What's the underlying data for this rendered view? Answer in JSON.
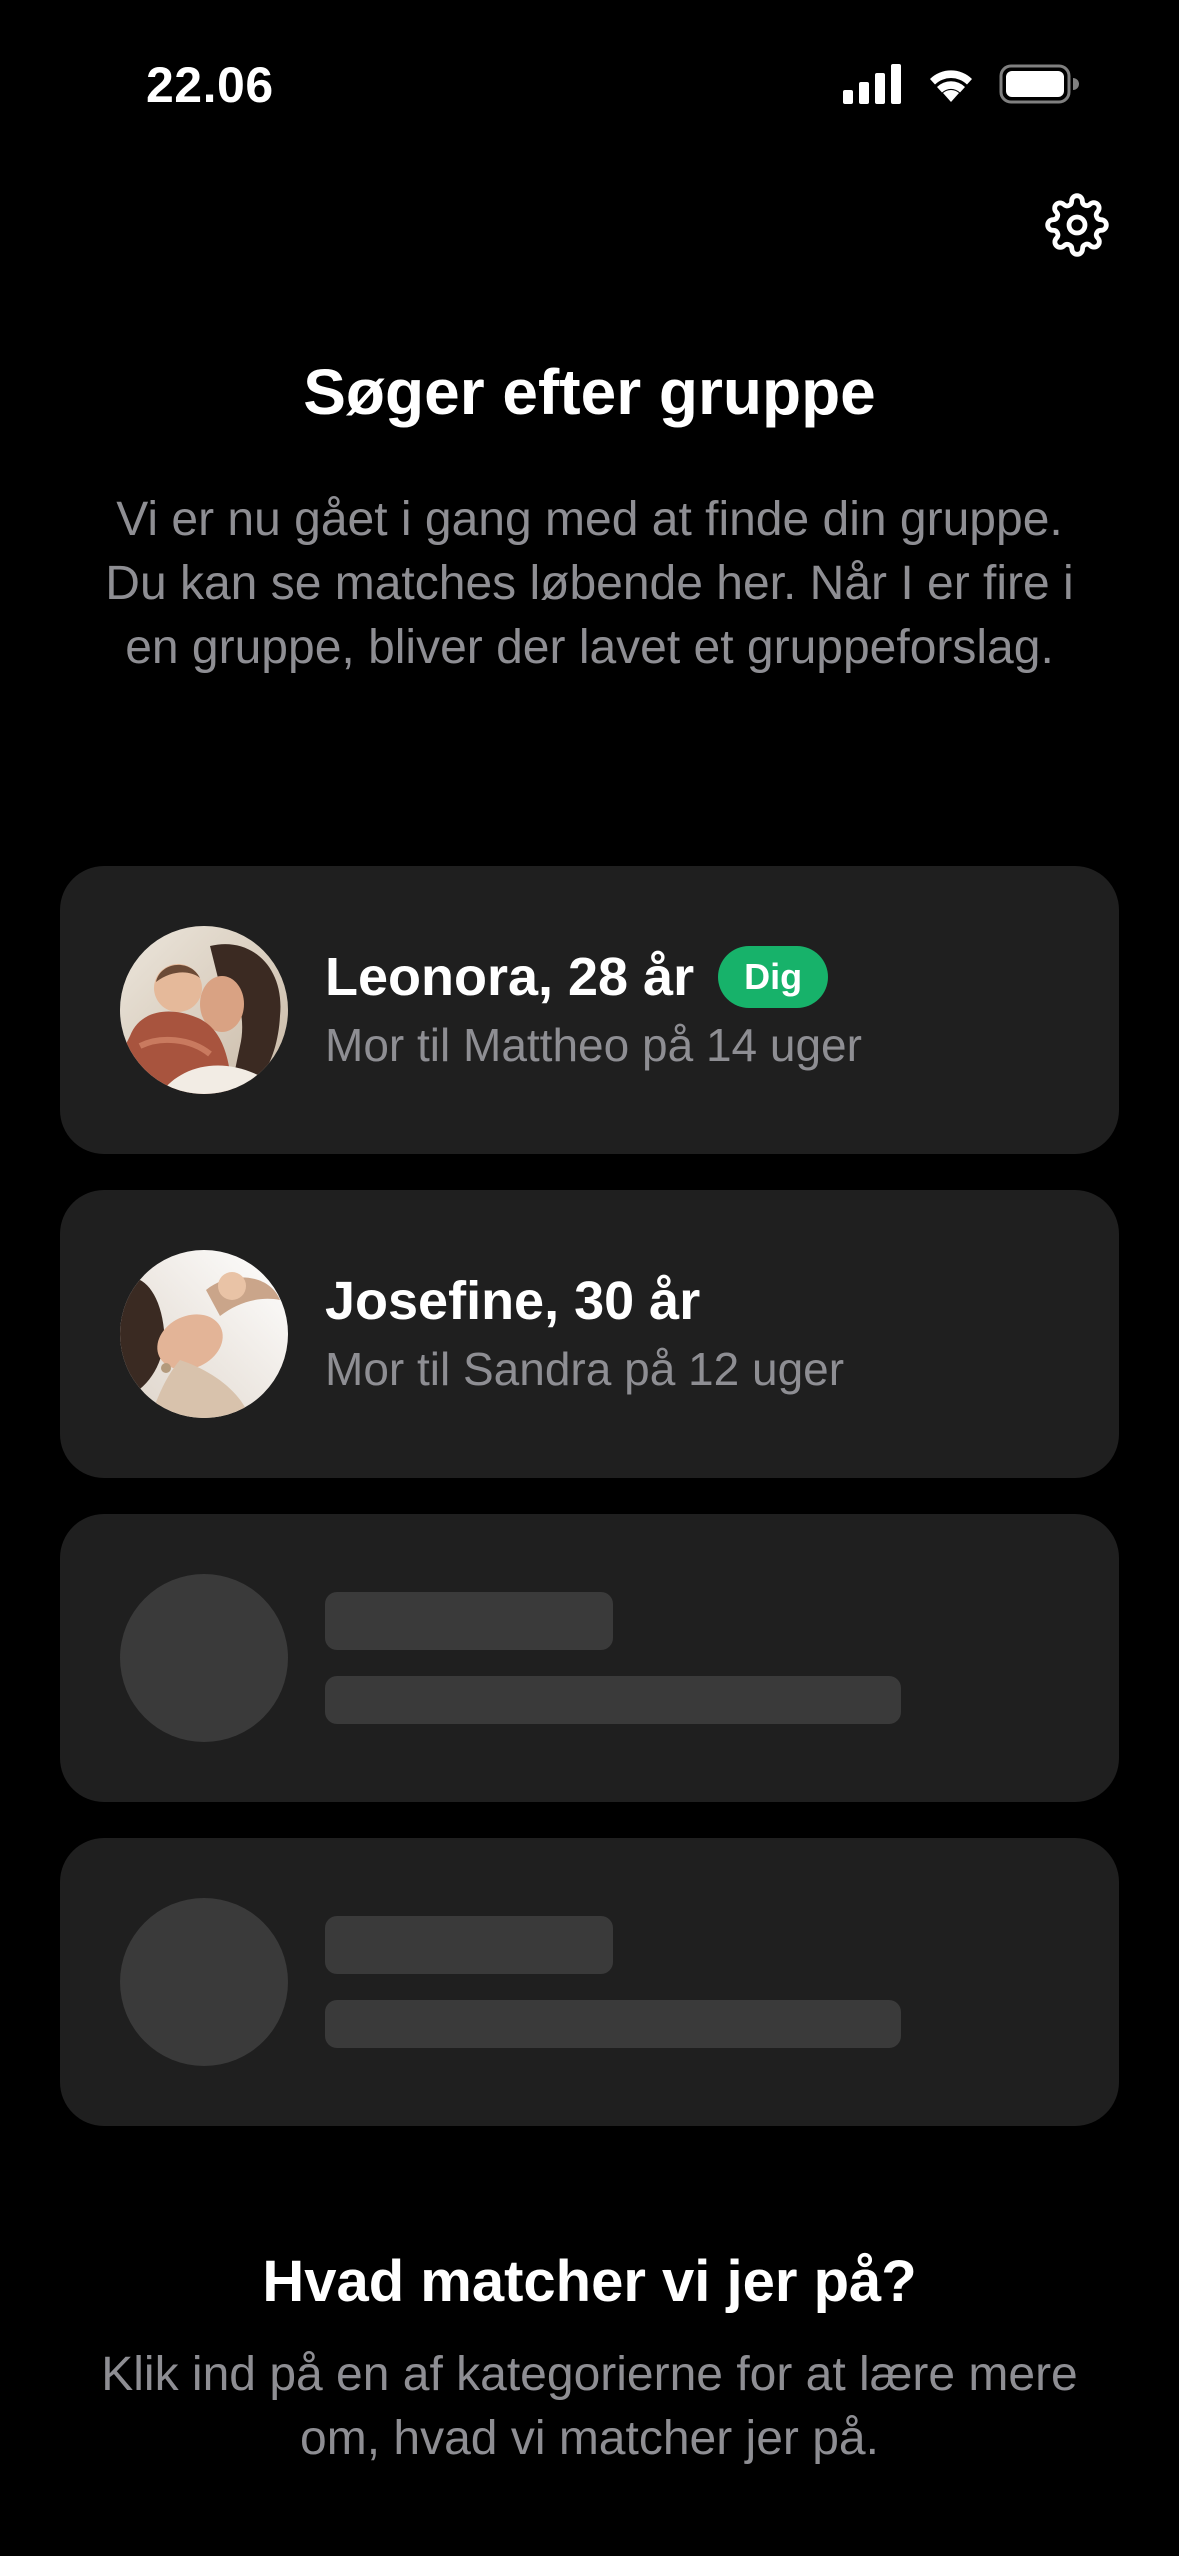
{
  "status_bar": {
    "time": "22.06",
    "icons": [
      "signal-icon",
      "wifi-icon",
      "battery-icon"
    ]
  },
  "header": {
    "settings_icon": "gear-icon"
  },
  "main": {
    "title": "Søger efter gruppe",
    "description": "Vi er nu gået i gang med at finde din gruppe. Du kan se matches løbende her. Når I er fire i en gruppe, bliver der lavet et gruppeforslag."
  },
  "members": [
    {
      "name": "Leonora, 28 år",
      "badge": "Dig",
      "subtitle": "Mor til Mattheo på 14 uger"
    },
    {
      "name": "Josefine, 30 år",
      "subtitle": "Mor til Sandra på 12 uger"
    }
  ],
  "placeholders": 2,
  "matching": {
    "title": "Hvad matcher vi jer på?",
    "description": "Klik ind på en af kategorierne for at lære mere om, hvad vi matcher jer på."
  },
  "colors": {
    "background": "#000000",
    "card": "#1f1f1f",
    "skeleton": "#3a3a3a",
    "badge": "#17b26a",
    "secondary_text": "#8e8e93"
  }
}
